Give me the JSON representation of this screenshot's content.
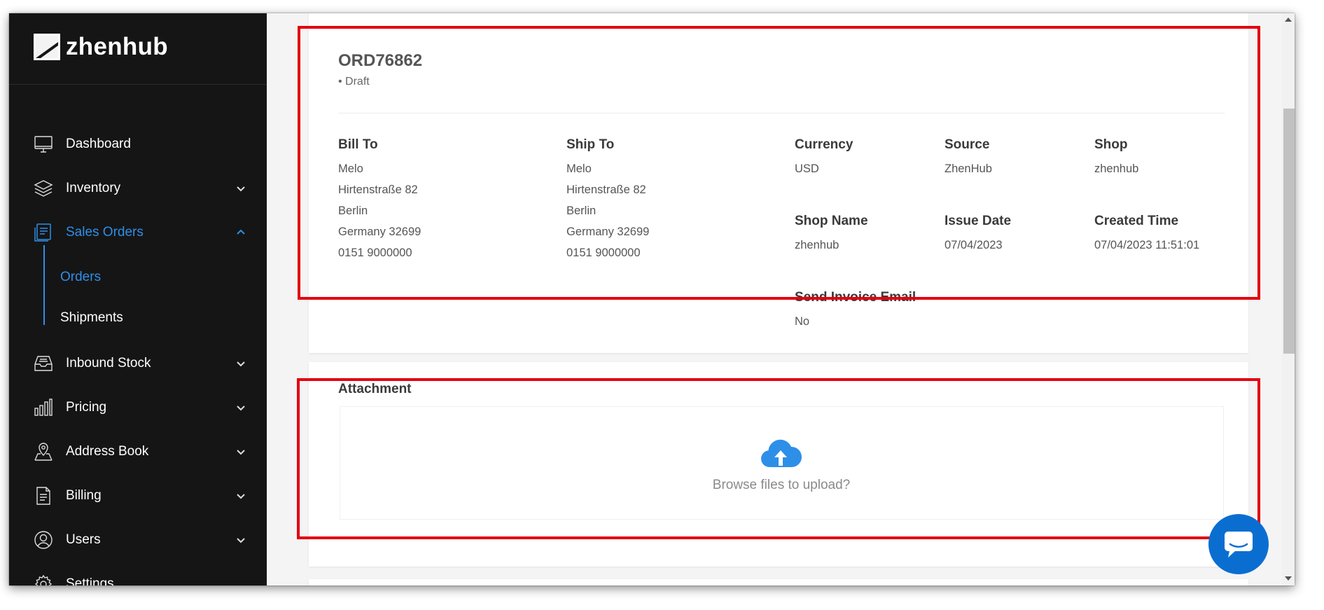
{
  "app": {
    "name": "zhenhub"
  },
  "sidebar": {
    "items": [
      {
        "label": "Dashboard",
        "icon": "monitor-icon"
      },
      {
        "label": "Inventory",
        "icon": "layers-icon"
      },
      {
        "label": "Sales Orders",
        "icon": "sales-orders-icon",
        "expanded": true
      },
      {
        "label": "Inbound Stock",
        "icon": "inbox-tray-icon"
      },
      {
        "label": "Pricing",
        "icon": "bar-chart-icon"
      },
      {
        "label": "Address Book",
        "icon": "map-pin-icon"
      },
      {
        "label": "Billing",
        "icon": "document-list-icon"
      },
      {
        "label": "Users",
        "icon": "users-icon"
      },
      {
        "label": "Settings",
        "icon": "gear-icon"
      }
    ],
    "sales_orders_children": [
      {
        "label": "Orders",
        "active": true
      },
      {
        "label": "Shipments",
        "active": false
      }
    ]
  },
  "order": {
    "id": "ORD76862",
    "status": "• Draft",
    "bill_to": {
      "label": "Bill To",
      "lines": [
        "Melo",
        "Hirtenstraße 82",
        "Berlin",
        "Germany 32699",
        "0151 9000000"
      ]
    },
    "ship_to": {
      "label": "Ship To",
      "lines": [
        "Melo",
        "Hirtenstraße 82",
        "Berlin",
        "Germany 32699",
        "0151 9000000"
      ]
    },
    "fields": [
      {
        "label": "Currency",
        "value": "USD"
      },
      {
        "label": "Source",
        "value": "ZhenHub"
      },
      {
        "label": "Shop",
        "value": "zhenhub"
      },
      {
        "label": "Shop Name",
        "value": "zhenhub"
      },
      {
        "label": "Issue Date",
        "value": "07/04/2023"
      },
      {
        "label": "Created Time",
        "value": "07/04/2023 11:51:01"
      },
      {
        "label": "Send Invoice Email",
        "value": "No"
      }
    ]
  },
  "attachment": {
    "title": "Attachment",
    "upload_text": "Browse files to upload?",
    "icon": "cloud-upload-icon"
  },
  "colors": {
    "sidebar_bg": "#151515",
    "accent": "#2e8fe8",
    "annotation_red": "#e3000f",
    "chat_blue": "#0a6ed1"
  }
}
